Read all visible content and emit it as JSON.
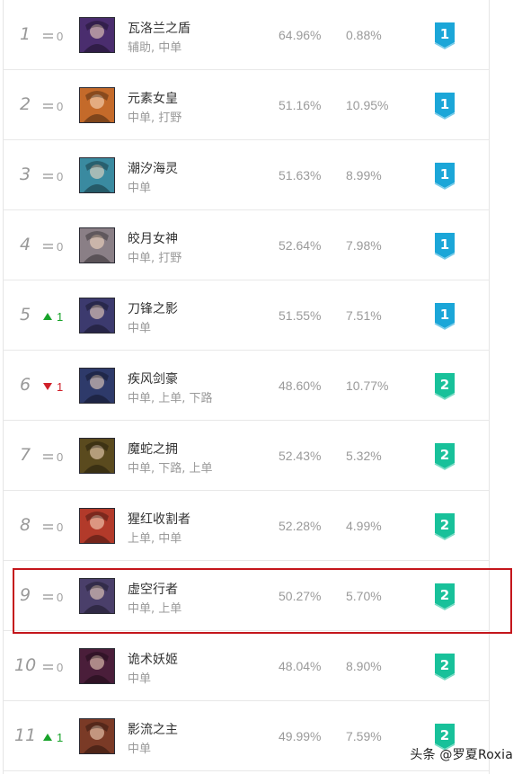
{
  "colors": {
    "tier1": "#1ba6d8",
    "tier2": "#18c19a",
    "up": "#18a32a",
    "down": "#d0202a",
    "highlight": "#c4161c"
  },
  "champions": [
    {
      "rank": "1",
      "trend": "eq",
      "change": "0",
      "name": "瓦洛兰之盾",
      "roles": "辅助, 中单",
      "winrate": "64.96%",
      "pickrate": "0.88%",
      "tier": "1",
      "avatar_color": "#4a2d6e"
    },
    {
      "rank": "2",
      "trend": "eq",
      "change": "0",
      "name": "元素女皇",
      "roles": "中单, 打野",
      "winrate": "51.16%",
      "pickrate": "10.95%",
      "tier": "1",
      "avatar_color": "#c46a2a"
    },
    {
      "rank": "3",
      "trend": "eq",
      "change": "0",
      "name": "潮汐海灵",
      "roles": "中单",
      "winrate": "51.63%",
      "pickrate": "8.99%",
      "tier": "1",
      "avatar_color": "#3a8aa0"
    },
    {
      "rank": "4",
      "trend": "eq",
      "change": "0",
      "name": "皎月女神",
      "roles": "中单, 打野",
      "winrate": "52.64%",
      "pickrate": "7.98%",
      "tier": "1",
      "avatar_color": "#8a7f86"
    },
    {
      "rank": "5",
      "trend": "up",
      "change": "1",
      "name": "刀锋之影",
      "roles": "中单",
      "winrate": "51.55%",
      "pickrate": "7.51%",
      "tier": "1",
      "avatar_color": "#3c3a6e"
    },
    {
      "rank": "6",
      "trend": "down",
      "change": "1",
      "name": "疾风剑豪",
      "roles": "中单, 上单, 下路",
      "winrate": "48.60%",
      "pickrate": "10.77%",
      "tier": "2",
      "avatar_color": "#2e3a6a"
    },
    {
      "rank": "7",
      "trend": "eq",
      "change": "0",
      "name": "魔蛇之拥",
      "roles": "中单, 下路, 上单",
      "winrate": "52.43%",
      "pickrate": "5.32%",
      "tier": "2",
      "avatar_color": "#5a4a1e"
    },
    {
      "rank": "8",
      "trend": "eq",
      "change": "0",
      "name": "猩红收割者",
      "roles": "上单, 中单",
      "winrate": "52.28%",
      "pickrate": "4.99%",
      "tier": "2",
      "avatar_color": "#b23a2a"
    },
    {
      "rank": "9",
      "trend": "eq",
      "change": "0",
      "name": "虚空行者",
      "roles": "中单, 上单",
      "winrate": "50.27%",
      "pickrate": "5.70%",
      "tier": "2",
      "avatar_color": "#4a3f6a"
    },
    {
      "rank": "10",
      "trend": "eq",
      "change": "0",
      "name": "诡术妖姬",
      "roles": "中单",
      "winrate": "48.04%",
      "pickrate": "8.90%",
      "tier": "2",
      "avatar_color": "#4a1e3a"
    },
    {
      "rank": "11",
      "trend": "up",
      "change": "1",
      "name": "影流之主",
      "roles": "中单",
      "winrate": "49.99%",
      "pickrate": "7.59%",
      "tier": "2",
      "avatar_color": "#7a3a26"
    }
  ],
  "watermark": "头条 @罗夏Roxia"
}
